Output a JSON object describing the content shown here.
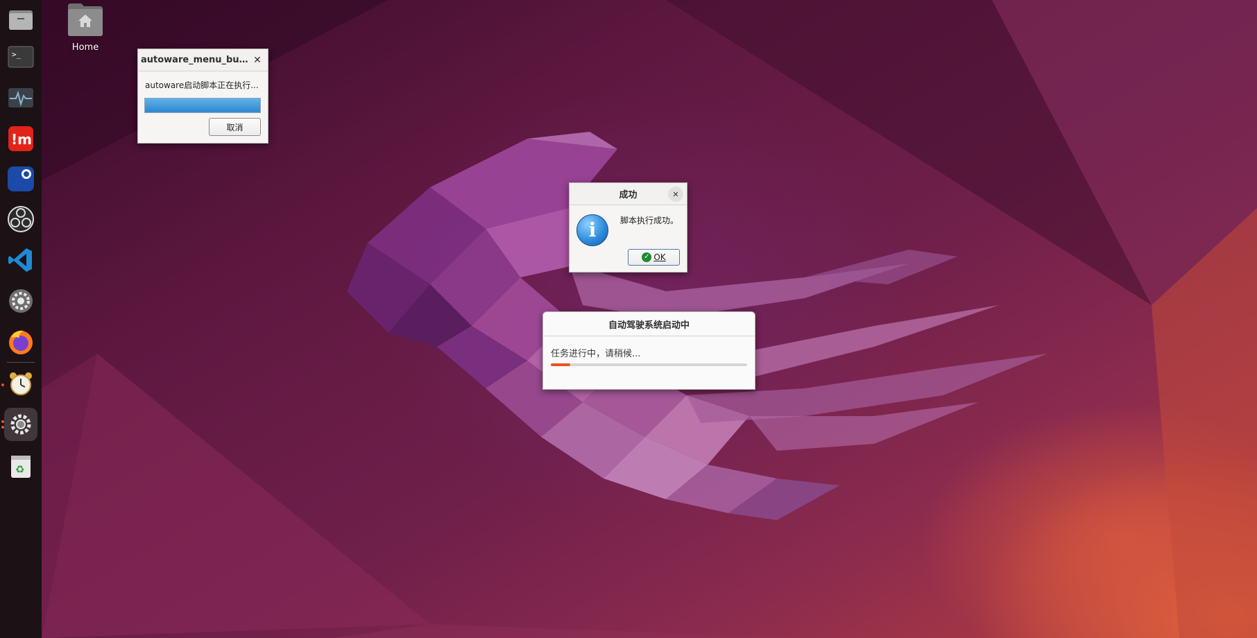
{
  "desktop": {
    "home_label": "Home"
  },
  "dock": {
    "items": [
      {
        "name": "files-icon"
      },
      {
        "name": "terminal-icon"
      },
      {
        "name": "system-monitor-icon"
      },
      {
        "name": "im-app-icon"
      },
      {
        "name": "remote-desktop-icon"
      },
      {
        "name": "obs-studio-icon"
      },
      {
        "name": "vscode-icon"
      },
      {
        "name": "settings-gear-icon"
      },
      {
        "name": "firefox-icon"
      },
      {
        "name": "alarm-clock-icon"
      },
      {
        "name": "settings-active-icon"
      },
      {
        "name": "trash-icon"
      }
    ]
  },
  "progress_dialog": {
    "title": "autoware_menu_but...",
    "message": "autoware启动脚本正在执行...",
    "cancel_label": "取消",
    "progress": 1.0,
    "bar_color": "#3d96d8"
  },
  "success_dialog": {
    "title": "成功",
    "message": "脚本执行成功。",
    "ok_label": "OK",
    "info_symbol": "i"
  },
  "startup_dialog": {
    "title": "自动驾驶系统启动中",
    "message": "任务进行中，请稍候...",
    "progress": 0.1,
    "bar_color": "#e95420"
  },
  "colors": {
    "accent": "#e95420",
    "dock_bg": "#1c1115"
  }
}
